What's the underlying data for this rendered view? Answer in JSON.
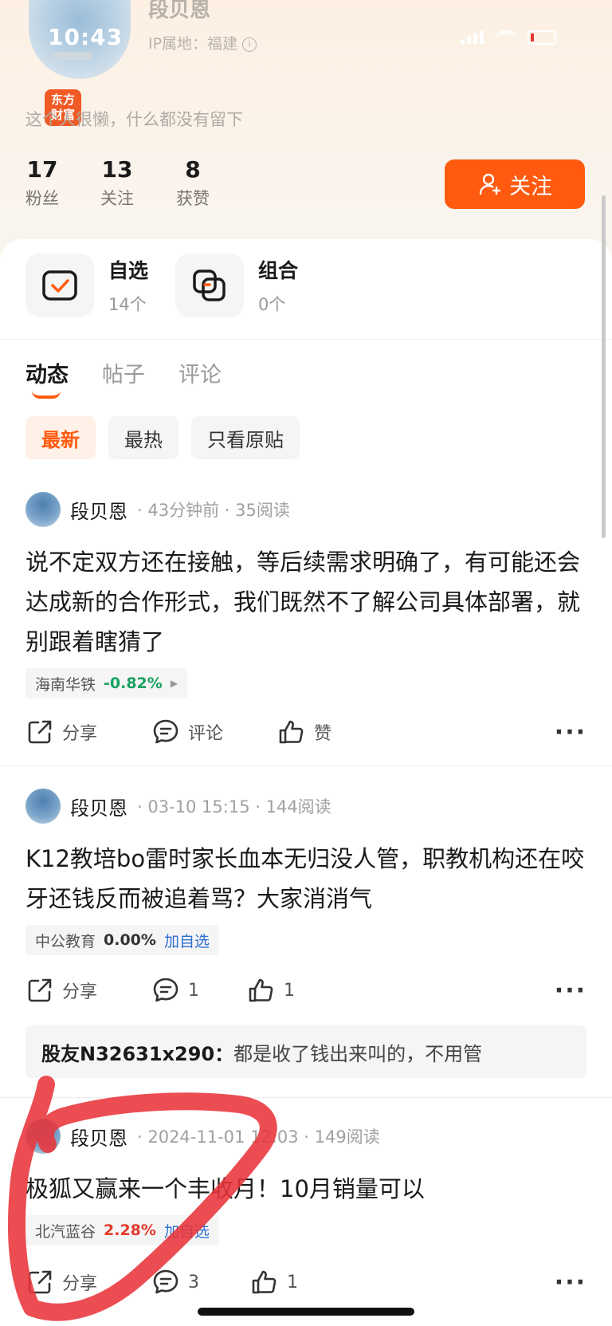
{
  "status_bar": {
    "time": "10:43"
  },
  "profile": {
    "name": "段贝恩",
    "ip_location": "IP属地：福建",
    "info_icon": "i",
    "brand_badge": "东方\n财富",
    "bio": "这个人很懒，什么都没有留下",
    "stats": [
      {
        "value": "17",
        "label": "粉丝"
      },
      {
        "value": "13",
        "label": "关注"
      },
      {
        "value": "8",
        "label": "获赞"
      }
    ],
    "follow_label": "关注"
  },
  "shortcuts": [
    {
      "title": "自选",
      "sub": "14个",
      "icon": "checkbox-icon"
    },
    {
      "title": "组合",
      "sub": "0个",
      "icon": "layers-icon"
    }
  ],
  "tabs": [
    "动态",
    "帖子",
    "评论"
  ],
  "filters": [
    "最新",
    "最热",
    "只看原贴"
  ],
  "posts": [
    {
      "author": "段贝恩",
      "meta": "· 43分钟前 · 35阅读",
      "text": "说不定双方还在接触，等后续需求明确了，有可能还会达成新的合作形式，我们既然不了解公司具体部署，就别跟着瞎猜了",
      "stock_name": "海南华铁",
      "stock_change": "-0.82%",
      "caret": "▶",
      "share": "分享",
      "comment": "评论",
      "like": "赞",
      "more": "···"
    },
    {
      "author": "段贝恩",
      "meta": "· 03-10 15:15 · 144阅读",
      "text": "K12教培bo雷时家长血本无归没人管，职教机构还在咬牙还钱反而被追着骂？大家消消气",
      "stock_name": "中公教育",
      "stock_change": "0.00%",
      "add_label": "加自选",
      "share": "分享",
      "comment": "1",
      "like": "1",
      "more": "···",
      "top_comment_user": "股友N32631x290：",
      "top_comment_text": "都是收了钱出来叫的，不用管"
    },
    {
      "author": "段贝恩",
      "meta": "· 2024-11-01 12:03 · 149阅读",
      "text": "极狐又赢来一个丰收月！10月销量可以",
      "stock_name": "北汽蓝谷",
      "stock_change": "2.28%",
      "add_label": "加自选",
      "share": "分享",
      "comment": "3",
      "like": "1",
      "more": "···"
    }
  ],
  "colors": {
    "accent": "#ff5a0f",
    "stock_down": "#1aa260",
    "stock_up": "#e23b2b",
    "link": "#2f6fcf",
    "annotation": "#e8343a"
  }
}
